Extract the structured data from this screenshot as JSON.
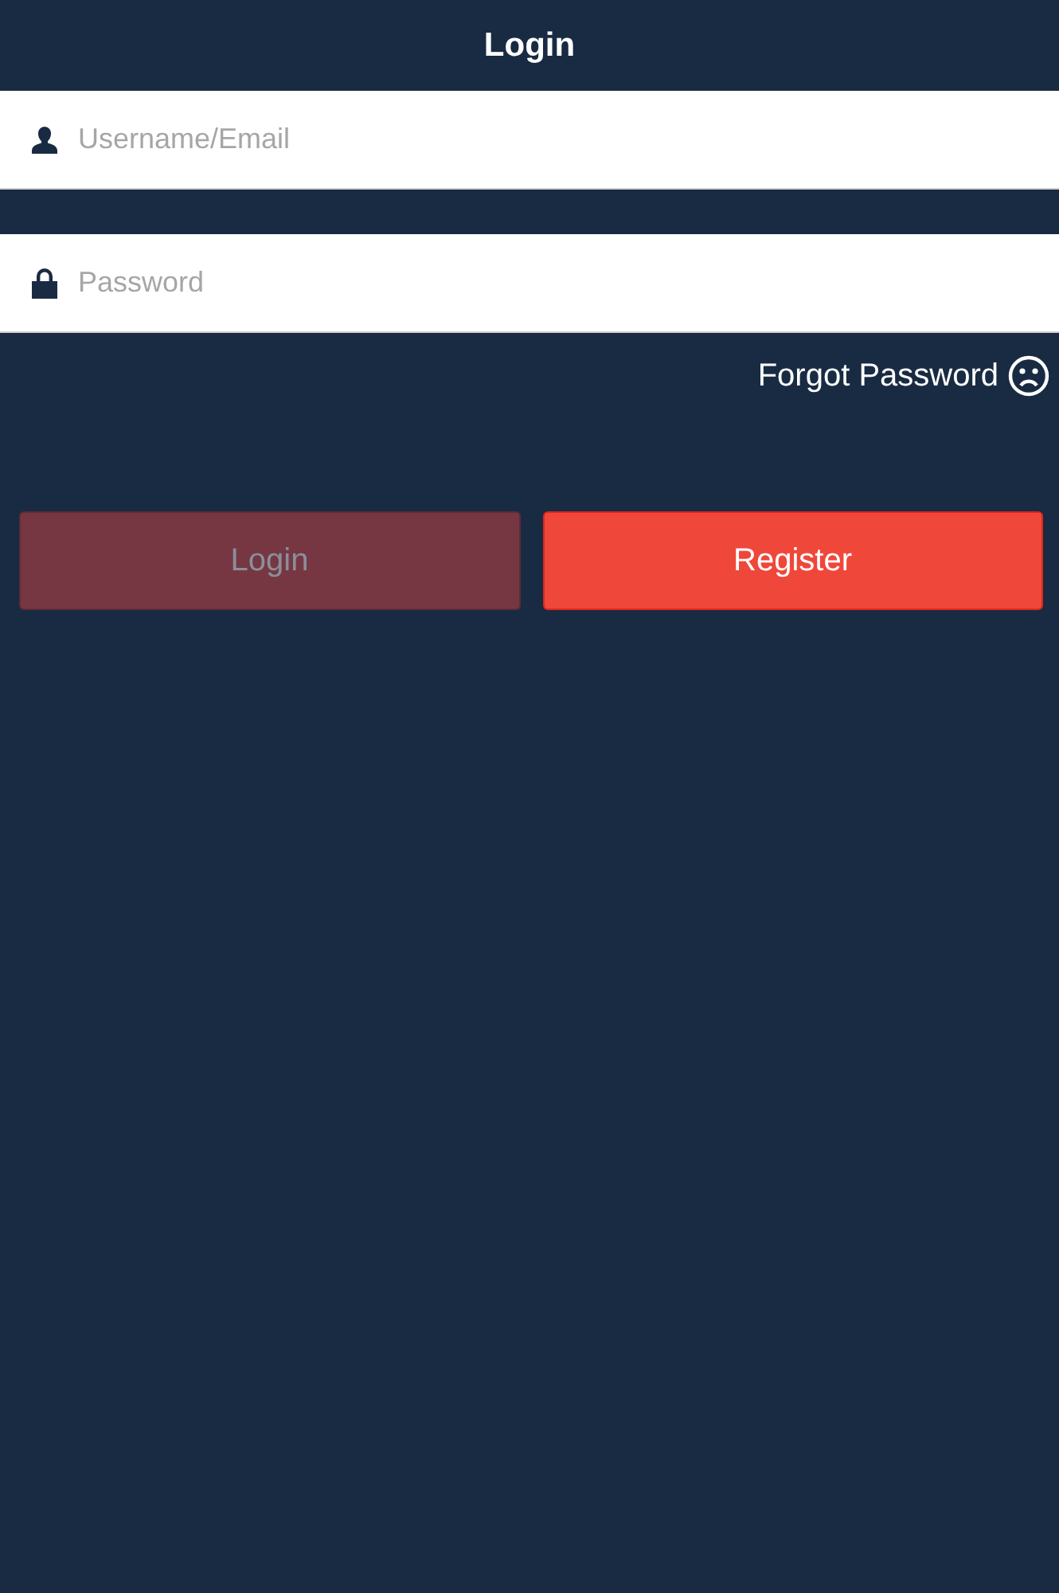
{
  "header": {
    "title": "Login"
  },
  "fields": [
    {
      "kind": "user",
      "placeholder": "Username/Email"
    },
    {
      "kind": "password",
      "placeholder": "Password"
    }
  ],
  "forgot_link": {
    "label": "Forgot Password"
  },
  "buttons": [
    {
      "label": "Login",
      "disabled": true
    },
    {
      "label": "Register",
      "disabled": false
    }
  ]
}
